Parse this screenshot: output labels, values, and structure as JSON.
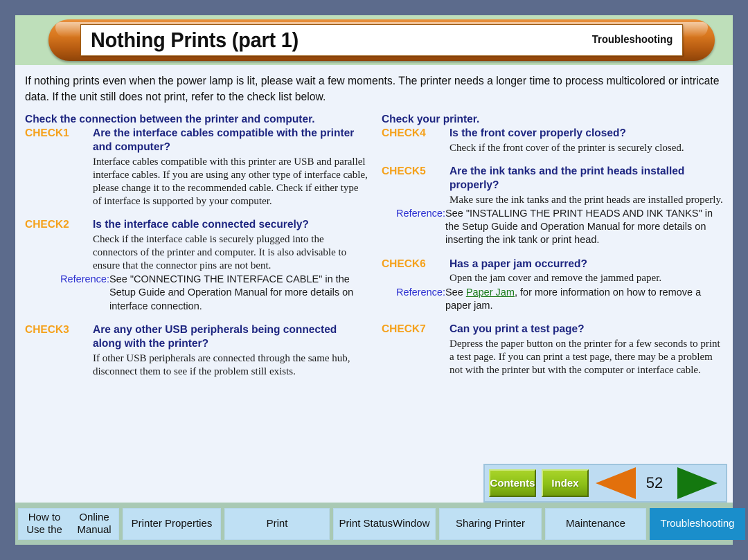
{
  "header": {
    "title": "Nothing Prints (part 1)",
    "section": "Troubleshooting"
  },
  "intro": "If nothing prints even when the power lamp is lit, please wait a few moments. The printer needs a longer time to process multicolored or intricate data. If the unit still does not print, refer to the check list below.",
  "left_column": {
    "heading": "Check the connection between the printer and computer.",
    "checks": [
      {
        "label": "CHECK1",
        "question": "Are the interface cables compatible with the printer and computer?",
        "text": "Interface cables compatible with this printer are USB and parallel interface cables. If you are using any other type of interface cable, please change it to the recommended cable. Check if either type of interface is supported by your computer."
      },
      {
        "label": "CHECK2",
        "question": "Is the interface cable connected securely?",
        "text": "Check if the interface cable is securely plugged into the connectors of the printer and computer. It is also advisable to ensure that the connector pins are not bent.",
        "reference_label": "Reference:",
        "reference_text": "See \"CONNECTING THE INTERFACE CABLE\" in the Setup Guide and Operation Manual for more details on interface connection."
      },
      {
        "label": "CHECK3",
        "question": "Are any other USB peripherals being connected along with the printer?",
        "text": "If other USB peripherals are connected through the same hub, disconnect them to see if the problem still exists."
      }
    ]
  },
  "right_column": {
    "heading": "Check your printer.",
    "checks": [
      {
        "label": "CHECK4",
        "question": "Is the front cover properly closed?",
        "text": "Check if the front cover of the printer is securely closed."
      },
      {
        "label": "CHECK5",
        "question": "Are the ink tanks and the print heads installed properly?",
        "text": "Make sure the ink tanks and the print heads are installed properly.",
        "reference_label": "Reference:",
        "reference_text": "See \"INSTALLING THE PRINT HEADS AND INK TANKS\" in the Setup Guide and Operation Manual for more details on inserting the ink tank or print head."
      },
      {
        "label": "CHECK6",
        "question": "Has a paper jam occurred?",
        "text": "Open the jam cover and remove the jammed paper.",
        "reference_label": "Reference:",
        "reference_prefix": "See ",
        "reference_link": "Paper Jam",
        "reference_suffix": ", for more information on how to remove a paper jam."
      },
      {
        "label": "CHECK7",
        "question": "Can you print a test page?",
        "text": "Depress the paper button on the printer for a few seconds to print a test page. If you can print a test page, there may be a problem not with the printer but with the computer or interface cable."
      }
    ]
  },
  "nav": {
    "contents_label": "Contents",
    "index_label": "Index",
    "page_number": "52",
    "prev_icon": "triangle-left-icon",
    "next_icon": "triangle-right-icon"
  },
  "tabs": [
    {
      "label": "How to Use the\nOnline Manual",
      "active": false
    },
    {
      "label": "Printer Properties",
      "active": false
    },
    {
      "label": "Print",
      "active": false
    },
    {
      "label": "Print Status\nWindow",
      "active": false
    },
    {
      "label": "Sharing Printer",
      "active": false
    },
    {
      "label": "Maintenance",
      "active": false
    },
    {
      "label": "Troubleshooting",
      "active": true
    }
  ],
  "colors": {
    "frame": "#5c6b8c",
    "header_band": "#bedfba",
    "content_bg": "#eef3fb",
    "heading_navy": "#1d2580",
    "check_orange": "#f5a11b",
    "reference_blue": "#2b2fd0",
    "link_green": "#1a7a1a",
    "tab_bg": "#bfe0f4",
    "tab_active": "#1a8ecb",
    "tabs_band": "#a9c9b4",
    "nav_panel": "#bedcf2",
    "nav_button": "#8cc017",
    "arrow_prev": "#e2700c",
    "arrow_next": "#14780f",
    "title_pill": "#d9781f"
  }
}
